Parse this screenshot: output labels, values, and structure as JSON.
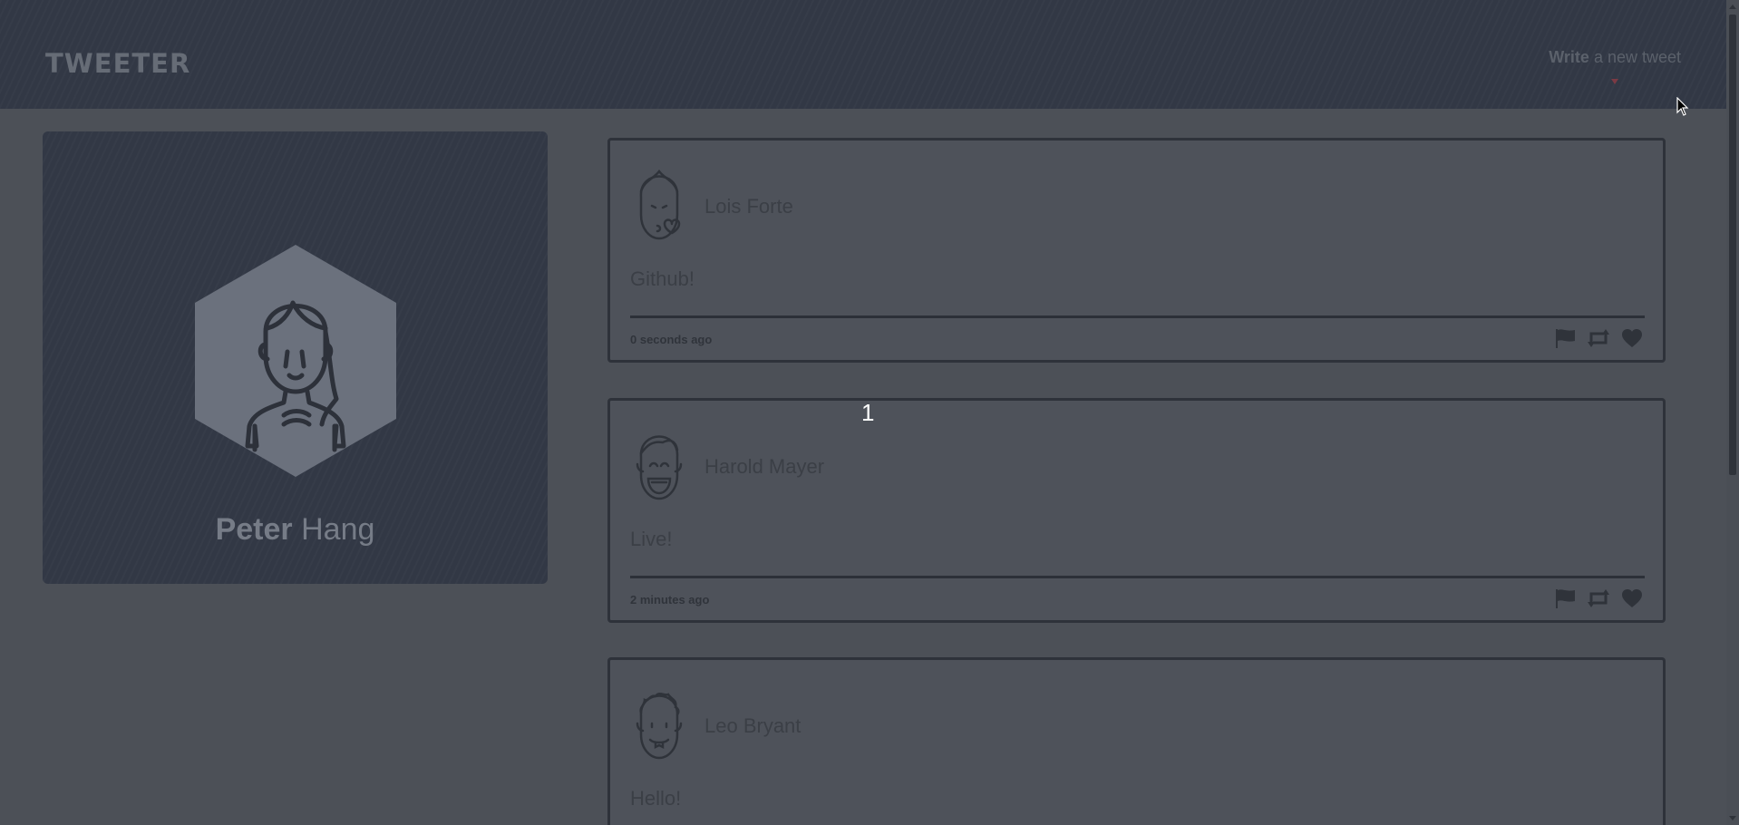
{
  "nav": {
    "brand": "TWEETER",
    "compose_bold": "Write",
    "compose_rest": " a new tweet"
  },
  "profile": {
    "first_name": "Peter",
    "last_name": "Hang",
    "avatar_icon": "woman-avatar-icon"
  },
  "tweets": [
    {
      "author": "Lois Forte",
      "content": "Github!",
      "time": "0 seconds ago",
      "avatar_icon": "woman-kiss-avatar-icon"
    },
    {
      "author": "Harold Mayer",
      "content": "Live!",
      "time": "2 minutes ago",
      "avatar_icon": "man-laughing-avatar-icon"
    },
    {
      "author": "Leo Bryant",
      "content": "Hello!",
      "avatar_icon": "man-curly-avatar-icon"
    }
  ],
  "overlay_badge": "1",
  "colors": {
    "page_bg": "#4c5057",
    "panel_bg": "#323845",
    "tweet_border": "#2e323a",
    "compose_arrow": "#7b3a44"
  }
}
